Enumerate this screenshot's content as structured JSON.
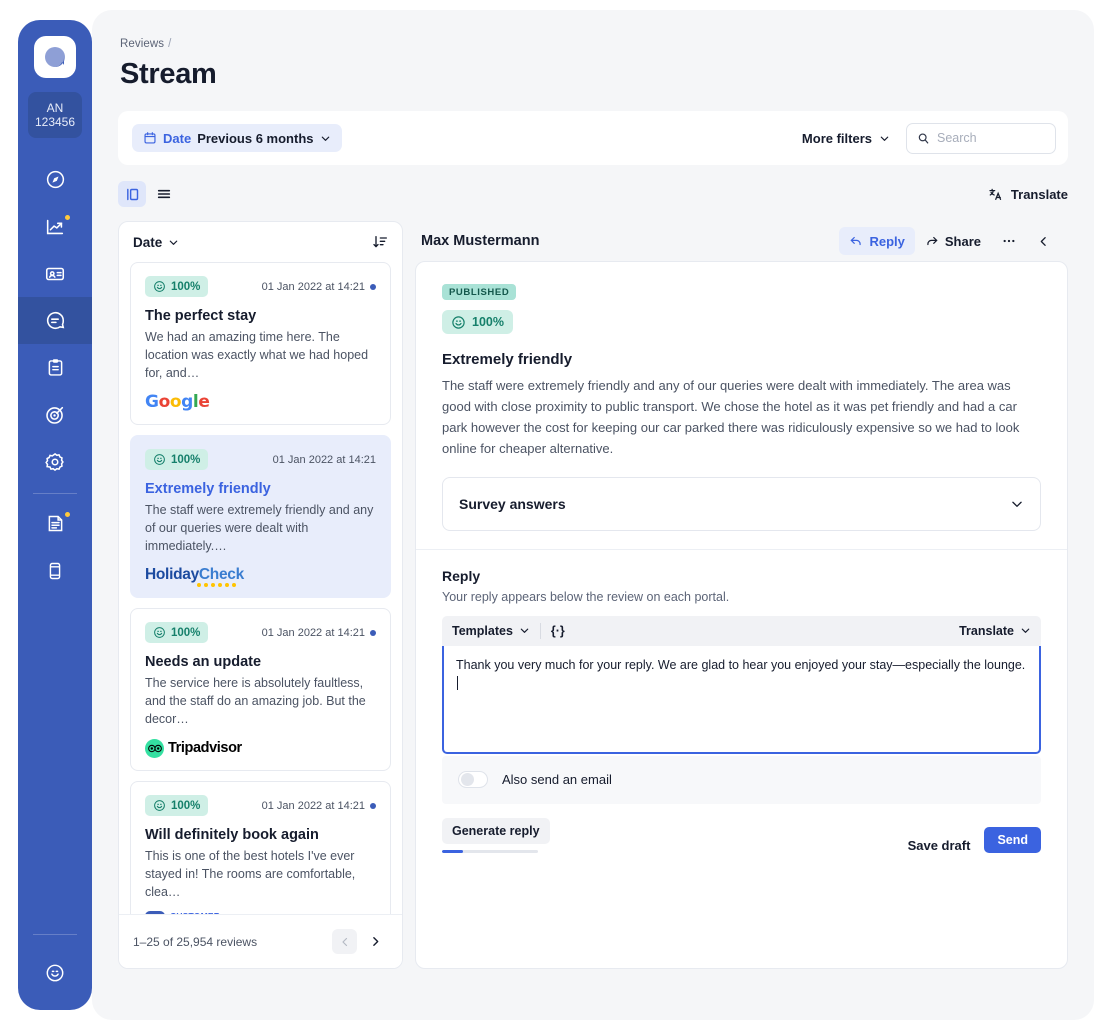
{
  "sidebar": {
    "logo_icon": "customer-alliance-logo",
    "account": {
      "initials": "AN",
      "number": "123456"
    },
    "items": [
      {
        "icon": "compass-icon",
        "name": "explore",
        "active": false,
        "badge": false
      },
      {
        "icon": "line-chart-icon",
        "name": "analytics",
        "active": false,
        "badge": true
      },
      {
        "icon": "id-card-icon",
        "name": "contacts",
        "active": false,
        "badge": false
      },
      {
        "icon": "chat-bubble-icon",
        "name": "reviews",
        "active": true,
        "badge": false
      },
      {
        "icon": "clipboard-icon",
        "name": "surveys",
        "active": false,
        "badge": false
      },
      {
        "icon": "target-icon",
        "name": "goals",
        "active": false,
        "badge": false
      },
      {
        "icon": "gear-icon",
        "name": "settings",
        "active": false,
        "badge": false
      }
    ],
    "items_secondary": [
      {
        "icon": "document-icon",
        "name": "reports",
        "active": false,
        "badge": true
      },
      {
        "icon": "mobile-icon",
        "name": "mobile",
        "active": false,
        "badge": false
      }
    ],
    "bottom": [
      {
        "icon": "smiley-icon",
        "name": "support"
      }
    ]
  },
  "header": {
    "breadcrumb_parent": "Reviews",
    "breadcrumb_separator": "/",
    "title": "Stream"
  },
  "filters": {
    "date_chip": {
      "icon": "calendar-icon",
      "key": "Date",
      "value": "Previous 6 months",
      "chevron": "chevron-down-icon"
    },
    "more_filters_label": "More filters",
    "search": {
      "icon": "search-icon",
      "placeholder": "Search",
      "value": ""
    }
  },
  "toolbar": {
    "view_split_icon": "split-view-icon",
    "view_list_icon": "list-view-icon",
    "translate_label": "Translate",
    "translate_icon": "translate-icon"
  },
  "list": {
    "sort_label": "Date",
    "sort_chevron_icon": "chevron-down-icon",
    "sort_direction_icon": "sort-descending-icon",
    "cards": [
      {
        "sentiment": "100%",
        "sentiment_icon": "smiley-icon",
        "date": "01 Jan 2022 at 14:21",
        "unread": true,
        "title": "The perfect stay",
        "snippet": "We had an amazing time here. The location was exactly what we had hoped for, and…",
        "source": "Google",
        "selected": false
      },
      {
        "sentiment": "100%",
        "sentiment_icon": "smiley-icon",
        "date": "01 Jan 2022 at 14:21",
        "unread": false,
        "title": "Extremely friendly",
        "snippet": "The staff were extremely friendly and any of our queries were dealt with immediately.…",
        "source": "HolidayCheck",
        "selected": true
      },
      {
        "sentiment": "100%",
        "sentiment_icon": "smiley-icon",
        "date": "01 Jan 2022 at 14:21",
        "unread": true,
        "title": "Needs an update",
        "snippet": "The service here is absolutely faultless, and the staff do an amazing job. But the decor…",
        "source": "Tripadvisor",
        "selected": false
      },
      {
        "sentiment": "100%",
        "sentiment_icon": "smiley-icon",
        "date": "01 Jan 2022 at 14:21",
        "unread": true,
        "title": "Will definitely book again",
        "snippet": "This is one of the best hotels I've ever stayed in! The rooms are comfortable, clea…",
        "source": "Customer Alliance",
        "selected": false
      }
    ],
    "footer": {
      "count_text": "1–25 of 25,954 reviews",
      "prev_icon": "chevron-left-icon",
      "next_icon": "chevron-right-icon"
    }
  },
  "detail": {
    "reviewer_name": "Max Mustermann",
    "actions": {
      "reply_label": "Reply",
      "reply_icon": "reply-arrow-icon",
      "share_label": "Share",
      "share_icon": "share-arrow-icon",
      "more_icon": "ellipsis-icon",
      "collapse_icon": "chevron-left-icon"
    },
    "status_badge": "PUBLISHED",
    "sentiment": "100%",
    "sentiment_icon": "smiley-icon",
    "review_title": "Extremely friendly",
    "review_text": "The staff were extremely friendly and any of our queries were dealt with immediately. The area was good with close proximity to public transport. We chose the hotel as it was pet friendly and had a car park however the cost for keeping our car parked there was ridiculously expensive so we had to look online for cheaper alternative.",
    "survey": {
      "label": "Survey answers",
      "chevron_icon": "chevron-down-icon"
    }
  },
  "reply": {
    "heading": "Reply",
    "subtext": "Your reply appears below the review on each portal.",
    "toolbar": {
      "templates_label": "Templates",
      "templates_chevron_icon": "chevron-down-icon",
      "placeholder_token_icon": "merge-tag-icon",
      "placeholder_token_label": "{·}",
      "translate_label": "Translate",
      "translate_chevron_icon": "chevron-down-icon"
    },
    "text": "Thank you very much for your reply. We are glad to hear you enjoyed your stay—especially the lounge.",
    "email_toggle": {
      "label": "Also send an email",
      "enabled": false
    },
    "generate_label": "Generate reply",
    "generate_progress_pct": 22,
    "save_draft_label": "Save draft",
    "send_label": "Send"
  },
  "colors": {
    "sidebar": "#3B5CB8",
    "sidebar_active": "#33529F",
    "accent": "#3B63E0",
    "chip_bg": "#E8EDFB",
    "sentiment_bg": "#CFEFE6",
    "sentiment_text": "#16806B",
    "published_bg": "#A9E2D6",
    "canvas": "#F5F6F8",
    "badge_dot": "#FFC93C"
  }
}
